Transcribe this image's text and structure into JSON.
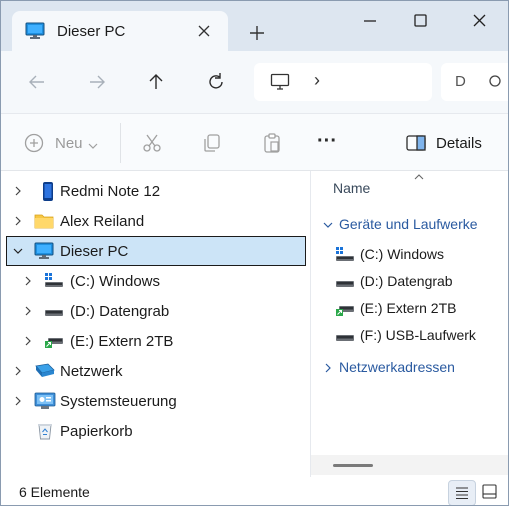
{
  "window": {
    "tab_title": "Dieser PC",
    "icons": {
      "tab": "monitor-icon",
      "close_tab": "close-icon",
      "new_tab": "plus-icon"
    },
    "controls": [
      "minimize-icon",
      "maximize-icon",
      "close-icon"
    ]
  },
  "nav": {
    "buttons": [
      "back-arrow-icon",
      "forward-arrow-icon",
      "up-arrow-icon",
      "refresh-icon"
    ],
    "address_chevron": "›",
    "search_placeholder": "D"
  },
  "toolbar": {
    "new_label": "Neu",
    "details_label": "Details",
    "more_label": "···",
    "icons": [
      "plus-circle-icon",
      "cut-icon",
      "copy-icon",
      "paste-icon",
      "more-icon",
      "details-pane-icon"
    ]
  },
  "navpane": {
    "items": [
      {
        "label": "Redmi Note 12",
        "icon": "phone-icon",
        "expanded": false,
        "level": 0
      },
      {
        "label": "Alex Reiland",
        "icon": "folder-icon",
        "expanded": false,
        "level": 0
      },
      {
        "label": "Dieser PC",
        "icon": "monitor-icon",
        "expanded": true,
        "level": 0,
        "selected": true
      },
      {
        "label": "(C:) Windows",
        "icon": "windows-drive-icon",
        "expanded": false,
        "level": 1
      },
      {
        "label": "(D:) Datengrab",
        "icon": "drive-icon",
        "expanded": false,
        "level": 1
      },
      {
        "label": "(E:) Extern 2TB",
        "icon": "external-drive-icon",
        "expanded": false,
        "level": 1
      },
      {
        "label": "Netzwerk",
        "icon": "network-icon",
        "expanded": false,
        "level": 0
      },
      {
        "label": "Systemsteuerung",
        "icon": "control-panel-icon",
        "expanded": false,
        "level": 0
      },
      {
        "label": "Papierkorb",
        "icon": "recycle-bin-icon",
        "expanded": false,
        "level": 0,
        "no_chevron": true
      }
    ]
  },
  "content": {
    "column_header": "Name",
    "groups": [
      {
        "label": "Geräte und Laufwerke",
        "expanded": true,
        "items": [
          {
            "label": "(C:) Windows",
            "icon": "windows-drive-icon"
          },
          {
            "label": "(D:) Datengrab",
            "icon": "drive-icon"
          },
          {
            "label": "(E:) Extern 2TB",
            "icon": "external-drive-icon"
          },
          {
            "label": "(F:) USB-Laufwerk",
            "icon": "drive-icon"
          }
        ]
      },
      {
        "label": "Netzwerkadressen",
        "expanded": false,
        "items": []
      }
    ]
  },
  "status": {
    "count": "6 Elemente",
    "view_buttons": [
      "details-view-icon",
      "tiles-view-icon"
    ]
  },
  "colors": {
    "accent": "#0067c0",
    "selection": "#cce4f7",
    "group_text": "#2a5aa0",
    "titlebar": "#dde6f0"
  }
}
